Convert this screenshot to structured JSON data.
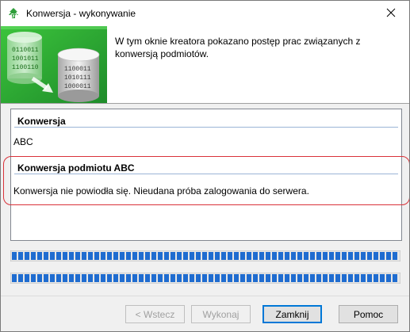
{
  "window": {
    "title": "Konwersja - wykonywanie",
    "icon": "app-gt-icon",
    "close_icon": "close-icon"
  },
  "header": {
    "description": "W tym oknie kreatora pokazano postęp prac związanych z konwersją podmiotów.",
    "banner_icon": "database-conversion-banner",
    "banner_digits_left": [
      "0110011",
      "1001011",
      "1100110"
    ],
    "banner_digits_right": [
      "1100011",
      "1010111",
      "1000011"
    ]
  },
  "log": {
    "section1": {
      "heading": "Konwersja",
      "text": "ABC"
    },
    "section2": {
      "heading": "Konwersja podmiotu ABC",
      "text": "Konwersja nie powiodła się. Nieudana próba zalogowania do serwera."
    }
  },
  "progress": [
    {
      "name": "overall",
      "value": 1.0
    },
    {
      "name": "current",
      "value": 1.0
    }
  ],
  "buttons": {
    "back": "< Wstecz",
    "execute": "Wykonaj",
    "close": "Zamknij",
    "help": "Pomoc"
  },
  "colors": {
    "banner_green": "#2fa82f",
    "progress_blue": "#1f6cd0",
    "highlight_red": "#d9323a",
    "section_line": "#9bb4d6"
  }
}
